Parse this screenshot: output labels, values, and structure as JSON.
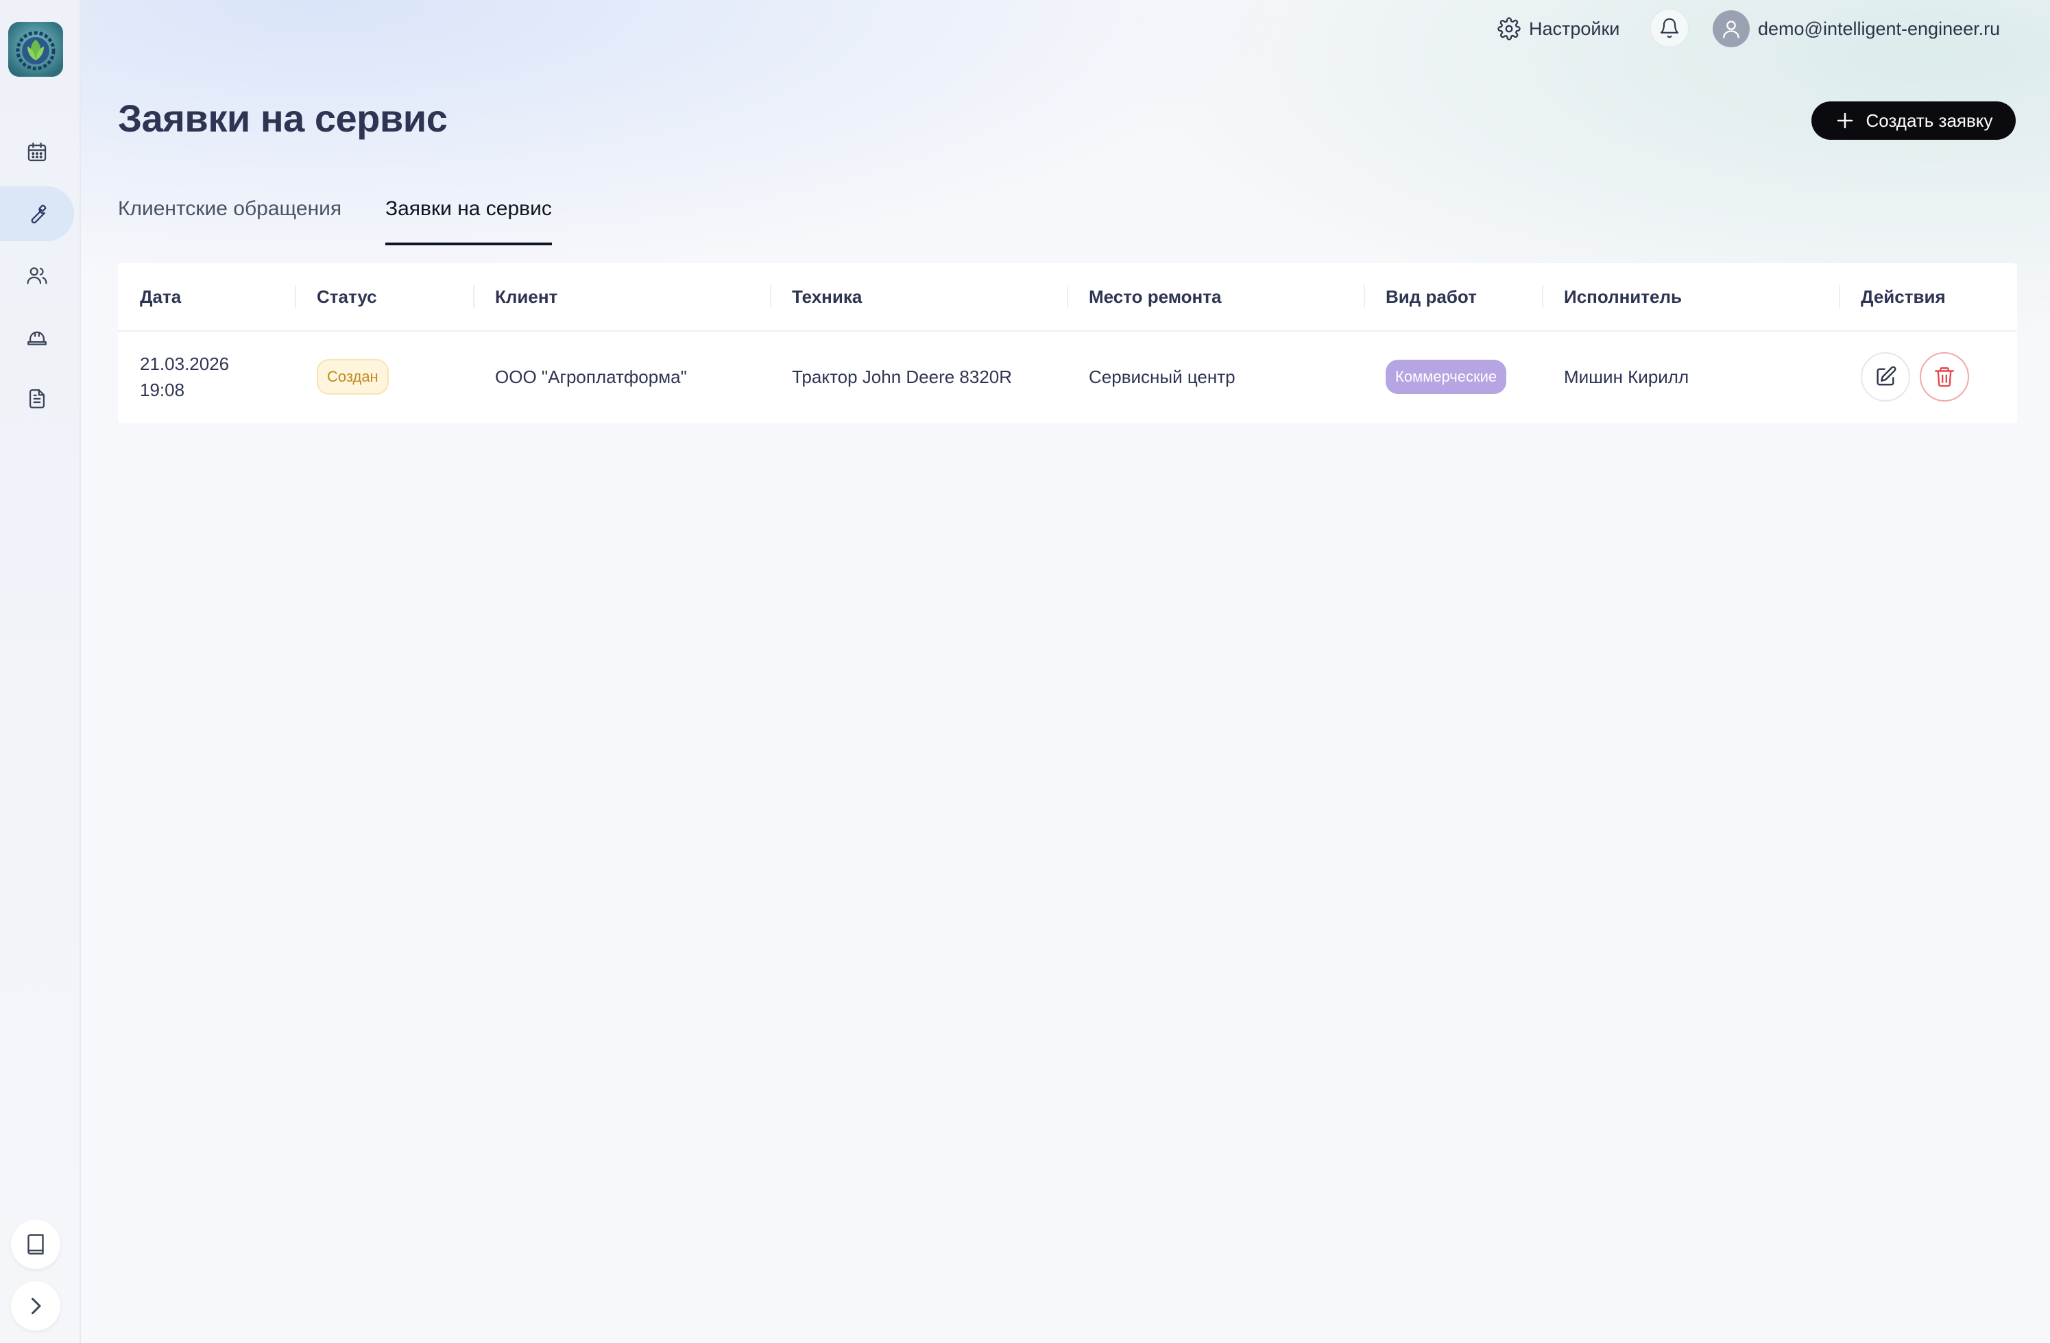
{
  "header": {
    "settings_label": "Настройки",
    "user_email": "demo@intelligent-engineer.ru"
  },
  "page": {
    "title": "Заявки на сервис",
    "create_button_label": "Создать заявку"
  },
  "tabs": [
    {
      "label": "Клиентские обращения",
      "active": false
    },
    {
      "label": "Заявки на сервис",
      "active": true
    }
  ],
  "sidebar": {
    "items": [
      {
        "icon": "calendar-icon",
        "active": false
      },
      {
        "icon": "wrench-icon",
        "active": true
      },
      {
        "icon": "users-icon",
        "active": false
      },
      {
        "icon": "hard-hat-icon",
        "active": false
      },
      {
        "icon": "document-icon",
        "active": false
      }
    ],
    "bottom": [
      {
        "icon": "book-icon"
      },
      {
        "icon": "chevron-right-icon"
      }
    ]
  },
  "table": {
    "columns": [
      "Дата",
      "Статус",
      "Клиент",
      "Техника",
      "Место ремонта",
      "Вид работ",
      "Исполнитель",
      "Действия"
    ],
    "rows": [
      {
        "date": "21.03.2026",
        "time": "19:08",
        "status": "Создан",
        "client": "ООО \"Агроплатформа\"",
        "equipment": "Трактор John Deere 8320R",
        "location": "Сервисный центр",
        "work_type": "Коммерческие",
        "executor": "Мишин Кирилл"
      }
    ]
  },
  "colors": {
    "accent": "#0b0b0f",
    "status_badge_bg": "#fff5dd",
    "status_badge_text": "#c08a1c",
    "work_badge_bg": "#b6a5e2",
    "delete_red": "#e5484d",
    "active_sidebar_bg": "#dbe6f6"
  }
}
